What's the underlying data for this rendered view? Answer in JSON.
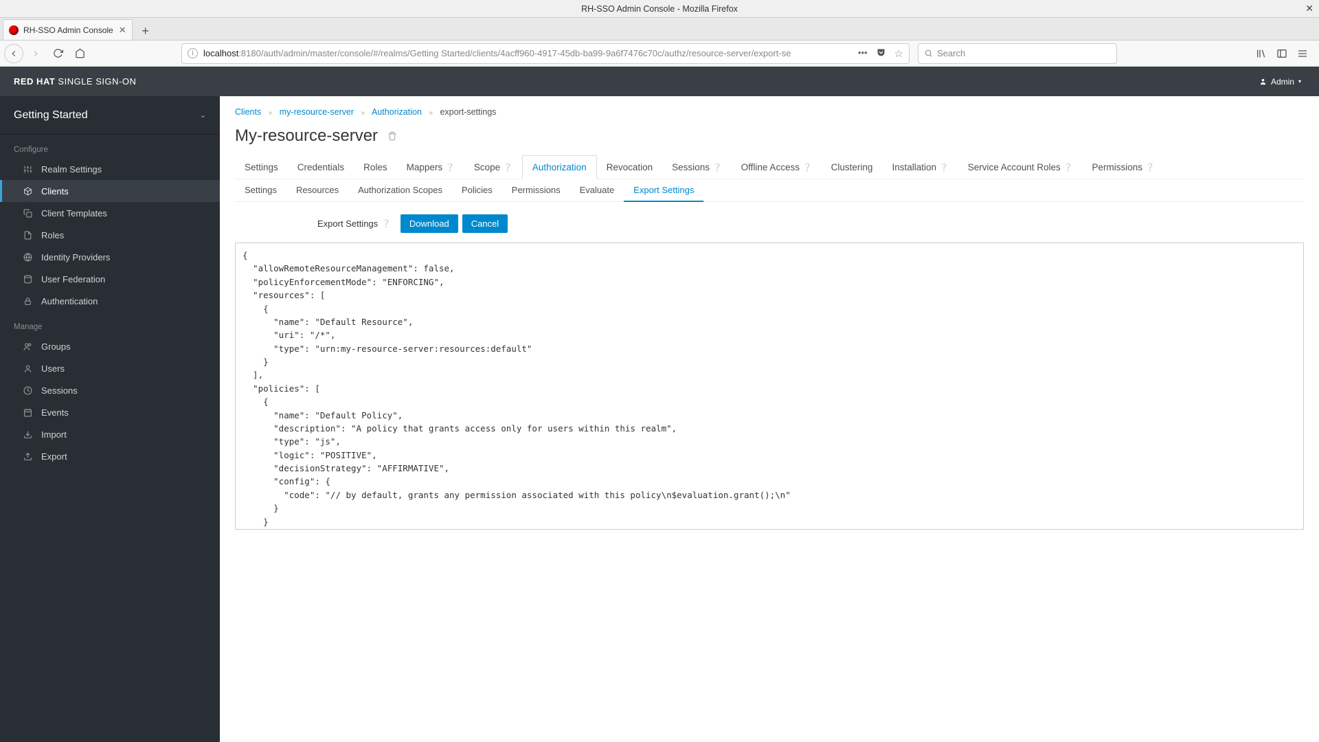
{
  "window": {
    "title": "RH-SSO Admin Console - Mozilla Firefox"
  },
  "browser": {
    "tab_title": "RH-SSO Admin Console",
    "url_host": "localhost",
    "url_rest": ":8180/auth/admin/master/console/#/realms/Getting Started/clients/4acff960-4917-45db-ba99-9a6f7476c70c/authz/resource-server/export-se",
    "search_placeholder": "Search"
  },
  "brand": {
    "strong": "RED HAT",
    "rest": " SINGLE SIGN-ON"
  },
  "user_menu": "Admin",
  "realm": "Getting Started",
  "sidebar": {
    "configure_label": "Configure",
    "manage_label": "Manage",
    "configure": [
      "Realm Settings",
      "Clients",
      "Client Templates",
      "Roles",
      "Identity Providers",
      "User Federation",
      "Authentication"
    ],
    "manage": [
      "Groups",
      "Users",
      "Sessions",
      "Events",
      "Import",
      "Export"
    ]
  },
  "breadcrumb": {
    "items": [
      "Clients",
      "my-resource-server",
      "Authorization"
    ],
    "current": "export-settings"
  },
  "page_title": "My-resource-server",
  "tabs": [
    "Settings",
    "Credentials",
    "Roles",
    "Mappers",
    "Scope",
    "Authorization",
    "Revocation",
    "Sessions",
    "Offline Access",
    "Clustering",
    "Installation",
    "Service Account Roles",
    "Permissions"
  ],
  "tabs_help": {
    "3": true,
    "4": true,
    "7": true,
    "8": true,
    "10": true,
    "11": true,
    "12": true
  },
  "subtabs": [
    "Settings",
    "Resources",
    "Authorization Scopes",
    "Policies",
    "Permissions",
    "Evaluate",
    "Export Settings"
  ],
  "form": {
    "label": "Export Settings",
    "download": "Download",
    "cancel": "Cancel"
  },
  "export_json": "{\n  \"allowRemoteResourceManagement\": false,\n  \"policyEnforcementMode\": \"ENFORCING\",\n  \"resources\": [\n    {\n      \"name\": \"Default Resource\",\n      \"uri\": \"/*\",\n      \"type\": \"urn:my-resource-server:resources:default\"\n    }\n  ],\n  \"policies\": [\n    {\n      \"name\": \"Default Policy\",\n      \"description\": \"A policy that grants access only for users within this realm\",\n      \"type\": \"js\",\n      \"logic\": \"POSITIVE\",\n      \"decisionStrategy\": \"AFFIRMATIVE\",\n      \"config\": {\n        \"code\": \"// by default, grants any permission associated with this policy\\n$evaluation.grant();\\n\"\n      }\n    }"
}
